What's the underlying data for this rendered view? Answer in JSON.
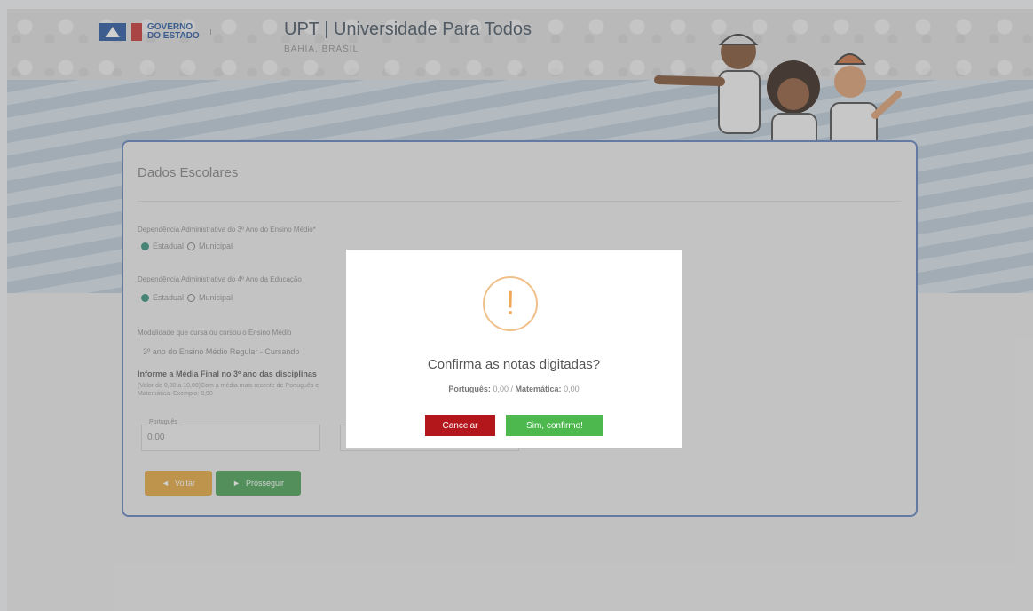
{
  "header": {
    "gov_logo_text_line1": "GOVERNO",
    "gov_logo_text_line2": "DO ESTADO",
    "title": "UPT | Universidade Para Todos",
    "subtitle": "BAHIA, BRASIL"
  },
  "form": {
    "section_title": "Dados Escolares",
    "q1_label": "Dependência Administrativa do 3º Ano do Ensino Médio*",
    "q1_options": [
      "Estadual",
      "Municipal"
    ],
    "q2_label": "Dependência Administrativa do 4º Ano da Educação",
    "q2_options": [
      "Estadual",
      "Municipal"
    ],
    "q3_label": "Modalidade que cursa ou cursou o Ensino Médio",
    "q3_value": "3º ano do Ensino Médio Regular - Cursando",
    "grades_title": "Informe a Média Final no 3º ano das disciplinas",
    "grades_help": "(Valor de 0,00 a 10,00)Com a média mais recente de Português e Matemática. Exemplo: 8,50",
    "portugues_label": "Português",
    "portugues_value": "0,00",
    "back_label": "Voltar",
    "next_label": "Prosseguir"
  },
  "modal": {
    "title": "Confirma as notas digitadas?",
    "portugues_key": "Português:",
    "portugues_value": "0,00",
    "separator": "/",
    "matematica_key": "Matemática:",
    "matematica_value": "0,00",
    "cancel_label": "Cancelar",
    "confirm_label": "Sim, confirmo!",
    "icon": "exclamation-icon"
  },
  "colors": {
    "accent_blue": "#5b7cb8",
    "cancel_red": "#b3161b",
    "confirm_green": "#4cb84e",
    "warning_orange": "#f0a858",
    "back_orange": "#e3a133",
    "next_green": "#3e9c4a",
    "radio_green": "#2b8a76"
  }
}
